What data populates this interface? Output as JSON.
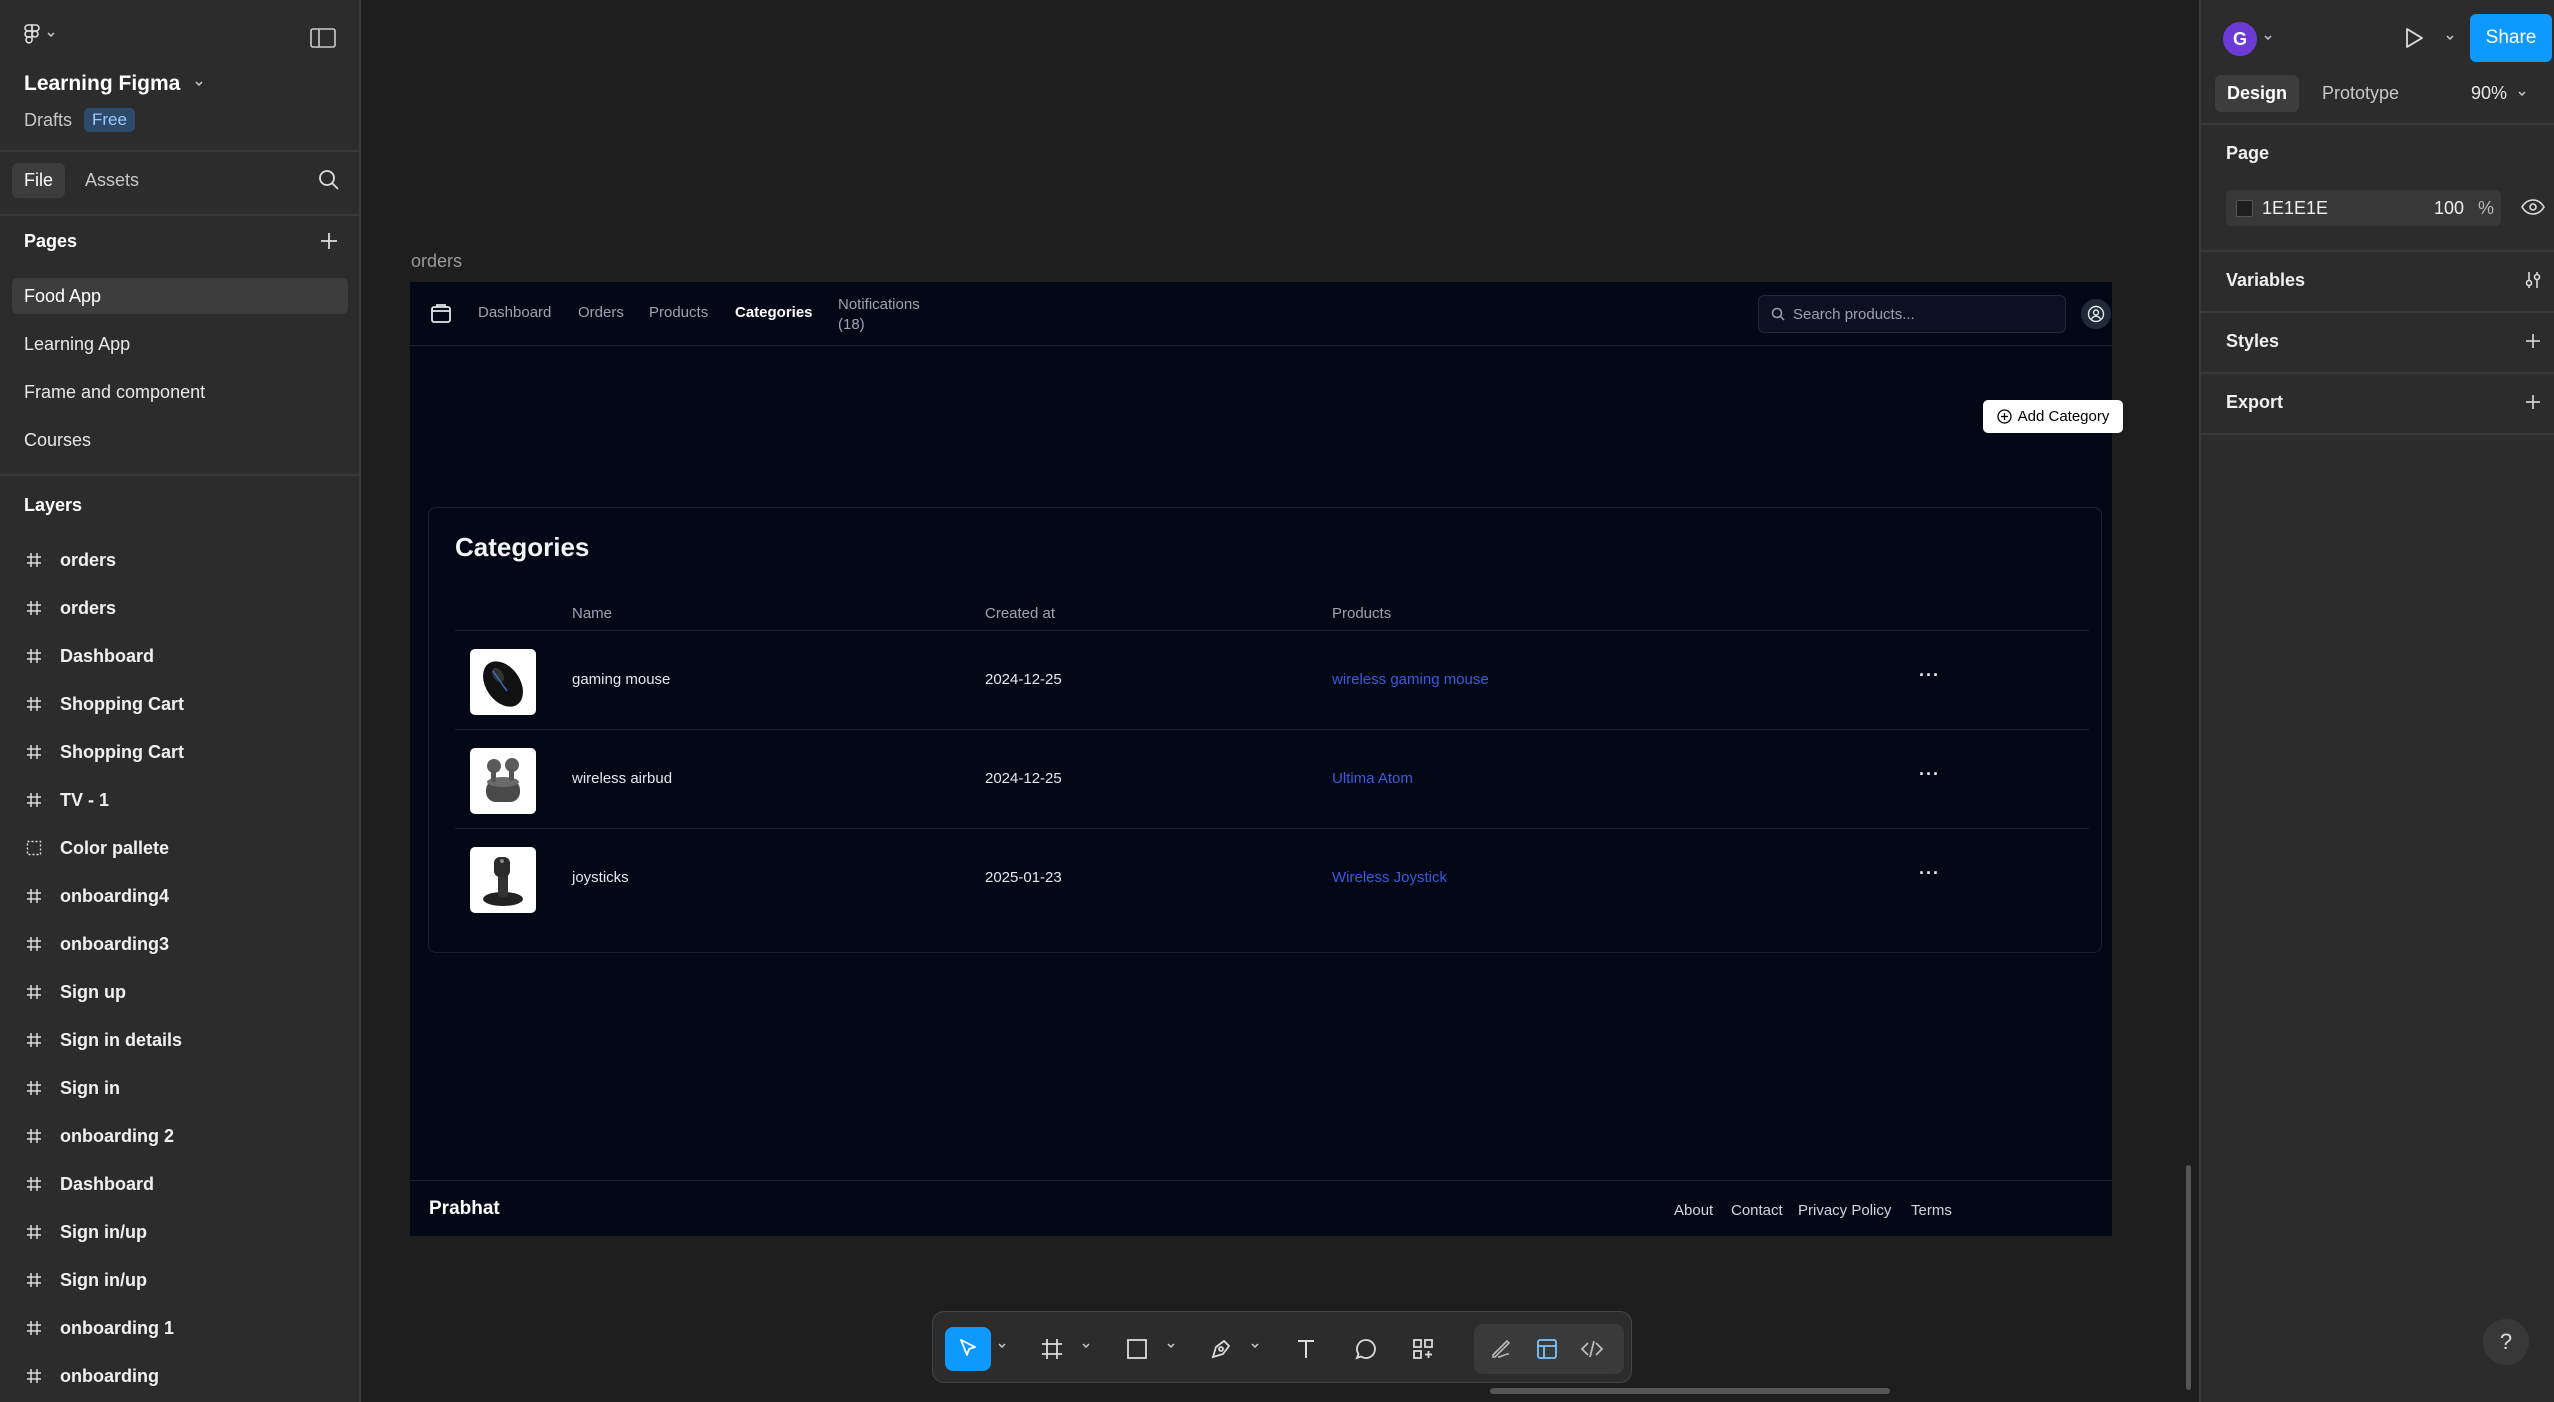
{
  "left_panel": {
    "file_name": "Learning Figma",
    "location": "Drafts",
    "plan_badge": "Free",
    "tabs": [
      "File",
      "Assets"
    ],
    "pages_title": "Pages",
    "pages": [
      "Food App",
      "Learning App",
      "Frame and component",
      "Courses"
    ],
    "layers_title": "Layers",
    "layers": [
      {
        "label": "orders",
        "icon": "frame-icon"
      },
      {
        "label": "orders",
        "icon": "frame-icon"
      },
      {
        "label": "Dashboard",
        "icon": "frame-icon"
      },
      {
        "label": "Shopping Cart",
        "icon": "frame-icon"
      },
      {
        "label": "Shopping Cart",
        "icon": "frame-icon"
      },
      {
        "label": "TV - 1",
        "icon": "frame-icon"
      },
      {
        "label": "Color pallete",
        "icon": "section-icon"
      },
      {
        "label": "onboarding4",
        "icon": "frame-icon"
      },
      {
        "label": "onboarding3",
        "icon": "frame-icon"
      },
      {
        "label": "Sign up",
        "icon": "frame-icon"
      },
      {
        "label": "Sign in details",
        "icon": "frame-icon"
      },
      {
        "label": "Sign in",
        "icon": "frame-icon"
      },
      {
        "label": "onboarding 2",
        "icon": "frame-icon"
      },
      {
        "label": "Dashboard",
        "icon": "frame-icon"
      },
      {
        "label": "Sign in/up",
        "icon": "frame-icon"
      },
      {
        "label": "Sign in/up",
        "icon": "frame-icon"
      },
      {
        "label": "onboarding 1",
        "icon": "frame-icon"
      },
      {
        "label": "onboarding",
        "icon": "frame-icon"
      }
    ]
  },
  "canvas": {
    "frame_label": "orders",
    "nav": {
      "links": [
        "Dashboard",
        "Orders",
        "Products",
        "Categories"
      ],
      "notifications_line1": "Notifications",
      "notifications_line2": "(18)",
      "search_placeholder": "Search products..."
    },
    "add_button": "Add Category",
    "card_title": "Categories",
    "columns": [
      "Name",
      "Created at",
      "Products"
    ],
    "rows": [
      {
        "name": "gaming mouse",
        "created": "2024-12-25",
        "product": "wireless gaming mouse",
        "thumb": "mouse-image"
      },
      {
        "name": "wireless airbud",
        "created": "2024-12-25",
        "product": "Ultima Atom",
        "thumb": "airbuds-image"
      },
      {
        "name": "joysticks",
        "created": "2025-01-23",
        "product": "Wireless Joystick",
        "thumb": "joystick-image"
      }
    ],
    "more_label": "···",
    "footer": {
      "brand": "Prabhat",
      "links": [
        "About",
        "Contact",
        "Privacy Policy",
        "Terms"
      ]
    }
  },
  "right_panel": {
    "avatar_initial": "G",
    "share_label": "Share",
    "tabs": [
      "Design",
      "Prototype"
    ],
    "zoom": "90%",
    "page_section": "Page",
    "page_color": "1E1E1E",
    "page_opacity": "100",
    "opacity_unit": "%",
    "sections": [
      "Variables",
      "Styles",
      "Export"
    ]
  },
  "colors": {
    "accent": "#0d99ff",
    "canvas_bg": "#1e1e1e",
    "frame_bg": "#030817",
    "link_blue": "#3b5bdb"
  }
}
